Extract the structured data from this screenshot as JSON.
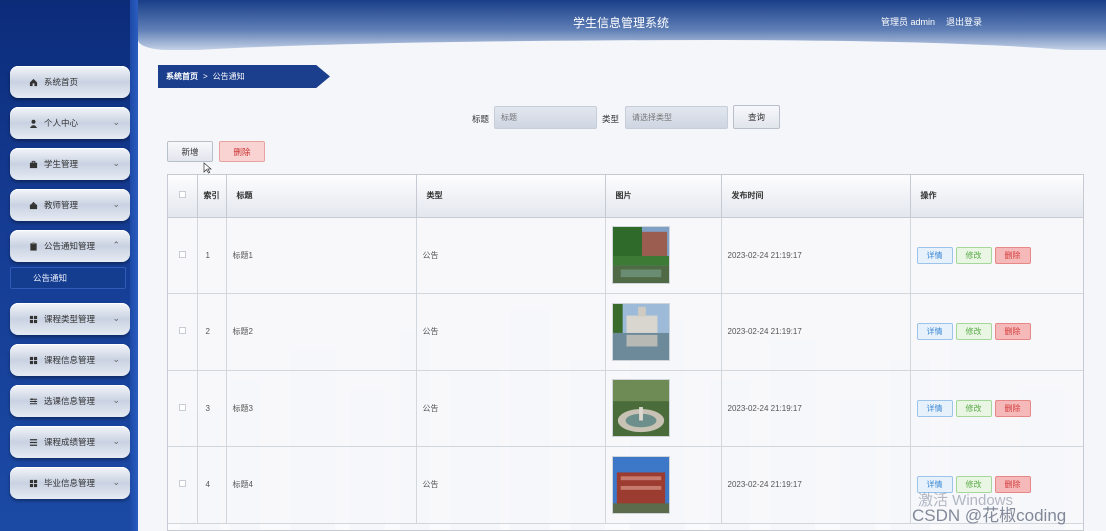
{
  "header": {
    "title": "学生信息管理系统",
    "user": "管理员 admin",
    "logout": "退出登录"
  },
  "sidebar": {
    "items": [
      {
        "label": "系统首页",
        "icon": "home-icon",
        "chevron": ""
      },
      {
        "label": "个人中心",
        "icon": "user-icon",
        "chevron": "⌄"
      },
      {
        "label": "学生管理",
        "icon": "briefcase-icon",
        "chevron": "⌄"
      },
      {
        "label": "教师管理",
        "icon": "teacher-icon",
        "chevron": "⌄"
      },
      {
        "label": "公告通知管理",
        "icon": "clipboard-icon",
        "chevron": "⌃"
      },
      {
        "label": "课程类型管理",
        "icon": "grid-icon",
        "chevron": "⌄"
      },
      {
        "label": "课程信息管理",
        "icon": "grid-icon",
        "chevron": "⌄"
      },
      {
        "label": "选课信息管理",
        "icon": "sliders-icon",
        "chevron": "⌄"
      },
      {
        "label": "课程成绩管理",
        "icon": "list-icon",
        "chevron": "⌄"
      },
      {
        "label": "毕业信息管理",
        "icon": "grid-icon",
        "chevron": "⌄"
      }
    ],
    "submenu": {
      "label": "公告通知"
    }
  },
  "breadcrumb": {
    "home": "系统首页",
    "separator": ">",
    "current": "公告通知"
  },
  "search": {
    "title_label": "标题",
    "title_placeholder": "标题",
    "type_label": "类型",
    "type_placeholder": "请选择类型",
    "button": "查询"
  },
  "toolbar": {
    "add": "新增",
    "delete": "删除"
  },
  "table": {
    "headers": {
      "index": "索引",
      "title": "标题",
      "type": "类型",
      "image": "图片",
      "time": "发布时间",
      "actions": "操作"
    },
    "rows": [
      {
        "index": "1",
        "title": "标题1",
        "type": "公告",
        "time": "2023-02-24 21:19:17",
        "image": "campus-trees-pond"
      },
      {
        "index": "2",
        "title": "标题2",
        "type": "公告",
        "time": "2023-02-24 21:19:17",
        "image": "campus-building-reflection"
      },
      {
        "index": "3",
        "title": "标题3",
        "type": "公告",
        "time": "2023-02-24 21:19:17",
        "image": "campus-fountain"
      },
      {
        "index": "4",
        "title": "标题4",
        "type": "公告",
        "time": "2023-02-24 21:19:17",
        "image": "campus-red-building"
      }
    ],
    "actions": {
      "detail": "详情",
      "edit": "修改",
      "delete": "删除"
    }
  },
  "watermarks": {
    "windows": "激活 Windows",
    "csdn": "CSDN @花椒coding"
  }
}
